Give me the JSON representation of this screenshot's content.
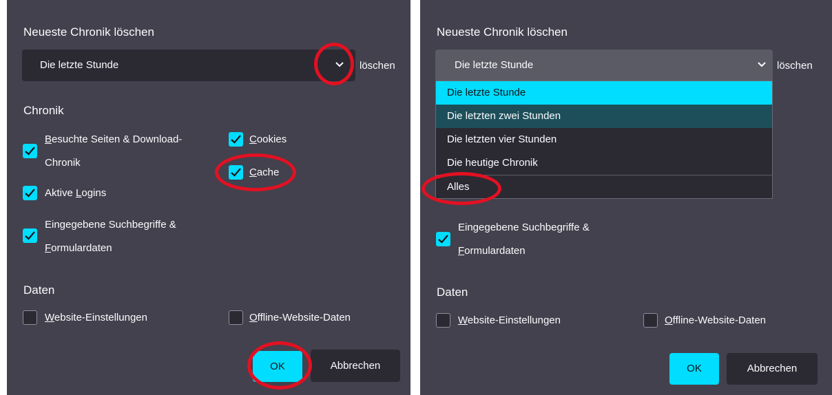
{
  "dialog": {
    "title": "Neueste Chronik löschen",
    "range_value": "Die letzte Stunde",
    "range_side_label": "löschen",
    "section_history": "Chronik",
    "section_data": "Daten",
    "options": {
      "history_pre": "B",
      "history_post": "esuchte Seiten & Download-",
      "history_line2": "Chronik",
      "cookies_pre": "C",
      "cookies_post": "ookies",
      "cache_pre": "C",
      "cache_post": "ache",
      "logins_pre": "Aktive ",
      "logins_u": "L",
      "logins_post": "ogins",
      "formdata_line1": "Eingegebene Suchbegriffe &",
      "formdata_u": "F",
      "formdata_post": "ormulardaten",
      "site_settings_u": "W",
      "site_settings_post": "ebsite-Einstellungen",
      "offline_u": "O",
      "offline_post": "ffline-Website-Daten"
    },
    "ok_label": "OK",
    "cancel_label": "Abbrechen"
  },
  "dropdown": {
    "items": [
      "Die letzte Stunde",
      "Die letzten zwei Stunden",
      "Die letzten vier Stunden",
      "Die heutige Chronik",
      "Alles"
    ]
  },
  "checkbox_states": {
    "history": true,
    "cookies": true,
    "cache": true,
    "logins": true,
    "formdata": true,
    "site_settings": false,
    "offline": false
  },
  "colors": {
    "panel_bg": "#42414d",
    "accent": "#00ddff",
    "annotation": "#e21122",
    "hover": "#1d4f5a"
  }
}
